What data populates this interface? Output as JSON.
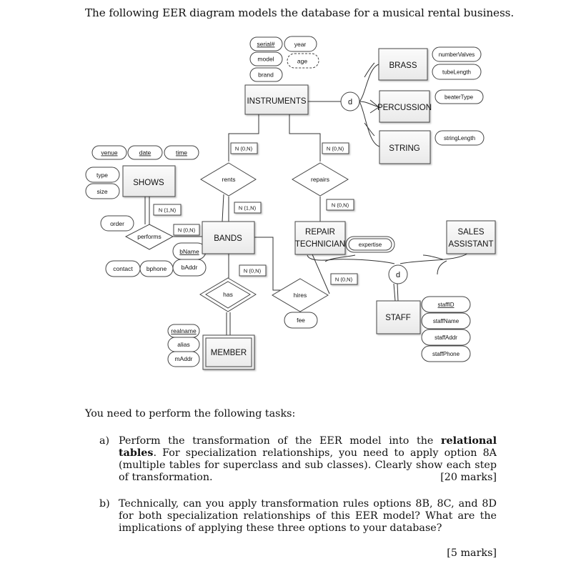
{
  "intro": "The following EER diagram models the database for a musical rental business.",
  "diagram": {
    "entities": {
      "instruments": "INSTRUMENTS",
      "brass": "BRASS",
      "percussion": "PERCUSSION",
      "string": "STRING",
      "shows": "SHOWS",
      "bands": "BANDS",
      "repair_technician_line1": "REPAIR",
      "repair_technician_line2": "TECHNICIAN",
      "sales_assistant_line1": "SALES",
      "sales_assistant_line2": "ASSISTANT",
      "staff": "STAFF",
      "member": "MEMBER"
    },
    "relationships": {
      "rents": "rents",
      "repairs": "repairs",
      "performs": "performs",
      "has": "has",
      "hires": "hires"
    },
    "specialization_symbols": {
      "instruments_disjoint": "d",
      "staff_disjoint": "d"
    },
    "attributes": {
      "instruments": {
        "serial": "serial#",
        "year": "year",
        "model": "model",
        "age": "age",
        "brand": "brand"
      },
      "brass": {
        "numberValves": "numberValves",
        "tubeLength": "tubeLength"
      },
      "percussion": {
        "beaterType": "beaterType"
      },
      "string": {
        "stringLength": "stringLength"
      },
      "shows": {
        "venue": "venue",
        "date": "date",
        "time": "time",
        "type": "type",
        "size": "size"
      },
      "performs": {
        "order": "order"
      },
      "bands": {
        "bName": "bName",
        "bAddr": "bAddr",
        "bphone": "bphone",
        "contact": "contact"
      },
      "repair_technician": {
        "expertise": "expertise"
      },
      "hires": {
        "fee": "fee"
      },
      "member": {
        "realname": "realname",
        "alias": "alias",
        "mAddr": "mAddr"
      },
      "staff": {
        "staffID": "staffID",
        "staffName": "staffName",
        "staffAddr": "staffAddr",
        "staffPhone": "staffPhone"
      }
    },
    "cardinalities": {
      "instruments_rents": "N (0,N)",
      "instruments_repairs": "N (0,N)",
      "shows_performs": "N (1,N)",
      "bands_rents": "N (1,N)",
      "repairs_technician": "N (0,N)",
      "bands_performs": "N (0,N)",
      "bands_hires": "N (0,N)",
      "technician_hires": "N (0,N)"
    }
  },
  "tasks": {
    "heading": "You need to perform the following tasks:",
    "a": {
      "label": "a)",
      "text_before": "Perform the transformation of the EER model into the ",
      "bold": "relational tables",
      "text_after": ". For specialization relationships, you need to apply option 8A (multiple tables for superclass and sub classes). Clearly show each step of transformation.",
      "marks": "[20 marks]"
    },
    "b": {
      "label": "b)",
      "text": "Technically, can you apply transformation rules options 8B, 8C, and 8D for both specialization relationships of this EER model? What are the implications of applying these three options to your database?",
      "marks": "[5 marks]"
    }
  }
}
